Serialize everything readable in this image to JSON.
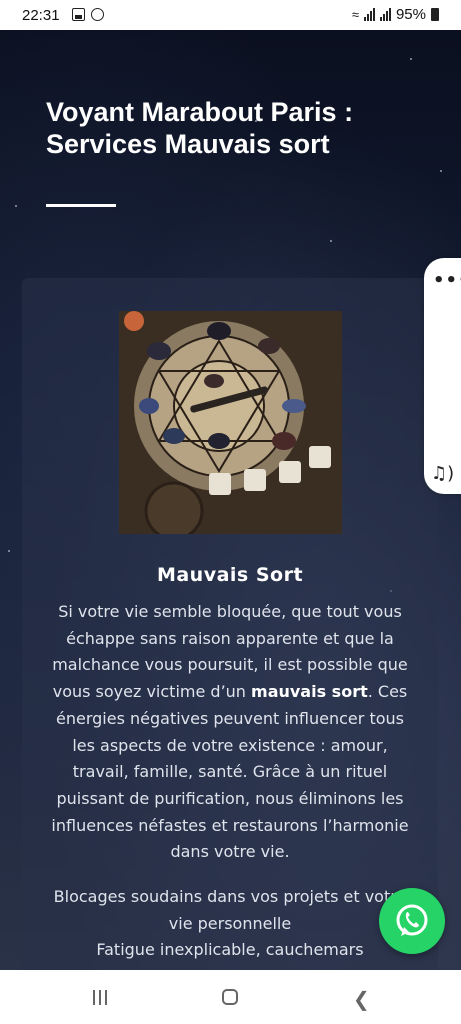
{
  "status_bar": {
    "time": "22:31",
    "battery": "95%"
  },
  "hero": {
    "title": "Voyant Marabout Paris : Services Mauvais sort"
  },
  "card": {
    "heading": "Mauvais Sort",
    "paragraph_before": "Si votre vie semble bloquée, que tout vous échappe sans raison apparente et que la malchance vous poursuit, il est possible que vous soyez victime d’un ",
    "paragraph_bold": "mauvais sort",
    "paragraph_after": ". Ces énergies négatives peuvent influencer tous les aspects de votre existence : amour, travail, famille, santé. Grâce à un rituel puissant de purification, nous éliminons les influences néfastes et restaurons l’harmonie dans votre vie.",
    "list_items": [
      "Blocages soudains dans vos projets et votre vie personnelle",
      "Fatigue inexplicable, cauchemars"
    ]
  },
  "side_tab": {
    "menu_icon": "more-dots-icon",
    "audio_icon": "audio-note-icon"
  },
  "floating": {
    "whatsapp_icon": "whatsapp-icon",
    "whatsapp_color": "#25d366"
  },
  "navbar": {
    "recents_icon": "recents-icon",
    "home_icon": "home-icon",
    "back_icon": "back-icon"
  }
}
